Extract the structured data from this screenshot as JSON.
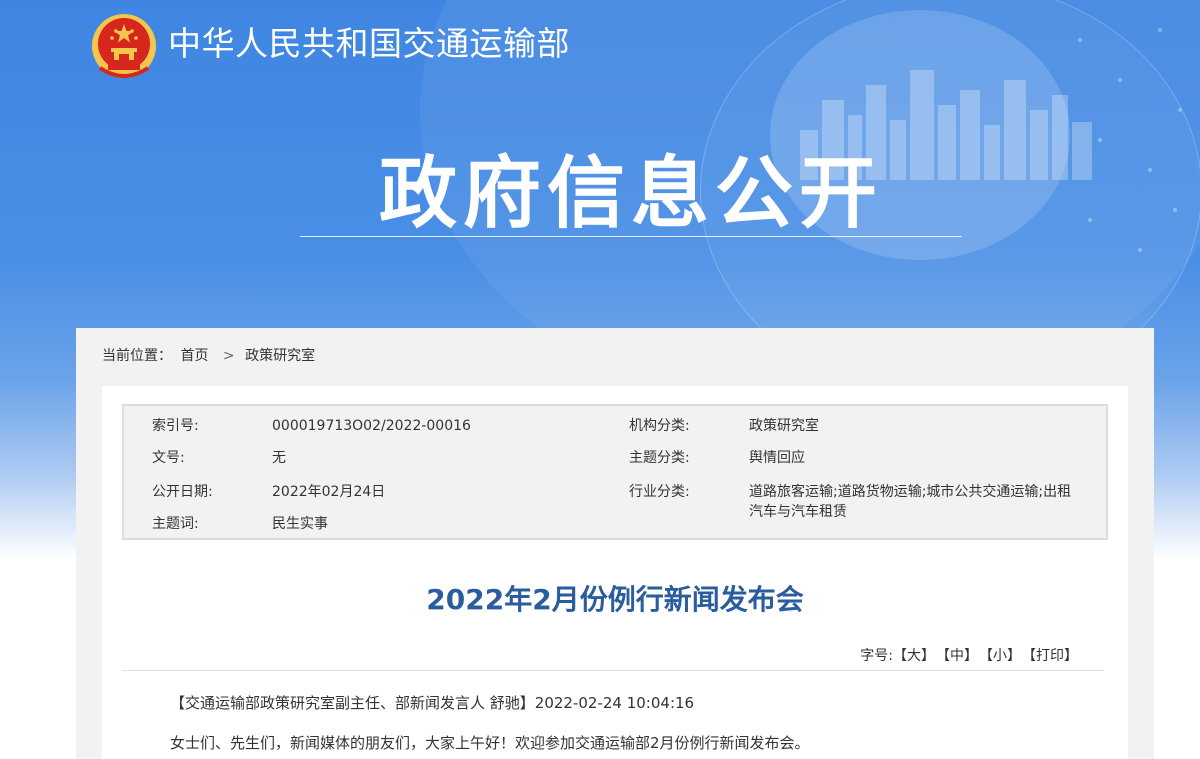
{
  "header": {
    "site_title": "中华人民共和国交通运输部",
    "banner_title": "政府信息公开"
  },
  "breadcrumb": {
    "label": "当前位置：",
    "items": [
      "首页",
      "政策研究室"
    ],
    "separator": ">"
  },
  "meta": {
    "rows": [
      {
        "label": "索引号:",
        "value": "000019713O02/2022-00016",
        "label2": "机构分类:",
        "value2": "政策研究室"
      },
      {
        "label": "文号:",
        "value": "无",
        "label2": "主题分类:",
        "value2": "舆情回应"
      },
      {
        "label": "公开日期:",
        "value": "2022年02月24日",
        "label2": "行业分类:",
        "value2": "道路旅客运输;道路货物运输;城市公共交通运输;出租汽车与汽车租赁"
      },
      {
        "label": "主题词:",
        "value": "民生实事",
        "label2": "",
        "value2": ""
      }
    ]
  },
  "article": {
    "title": "2022年2月份例行新闻发布会",
    "font_size_label": "字号:",
    "font_large": "【大】",
    "font_medium": "【中】",
    "font_small": "【小】",
    "print": "【打印】",
    "paragraphs": [
      "【交通运输部政策研究室副主任、部新闻发言人 舒驰】2022-02-24 10:04:16",
      "女士们、先生们，新闻媒体的朋友们，大家上午好！欢迎参加交通运输部2月份例行新闻发布会。"
    ]
  },
  "colors": {
    "banner_blue": "#3f86e2",
    "title_blue": "#2a5c9e",
    "emblem_red": "#d7261d",
    "emblem_gold": "#f4c64b"
  }
}
